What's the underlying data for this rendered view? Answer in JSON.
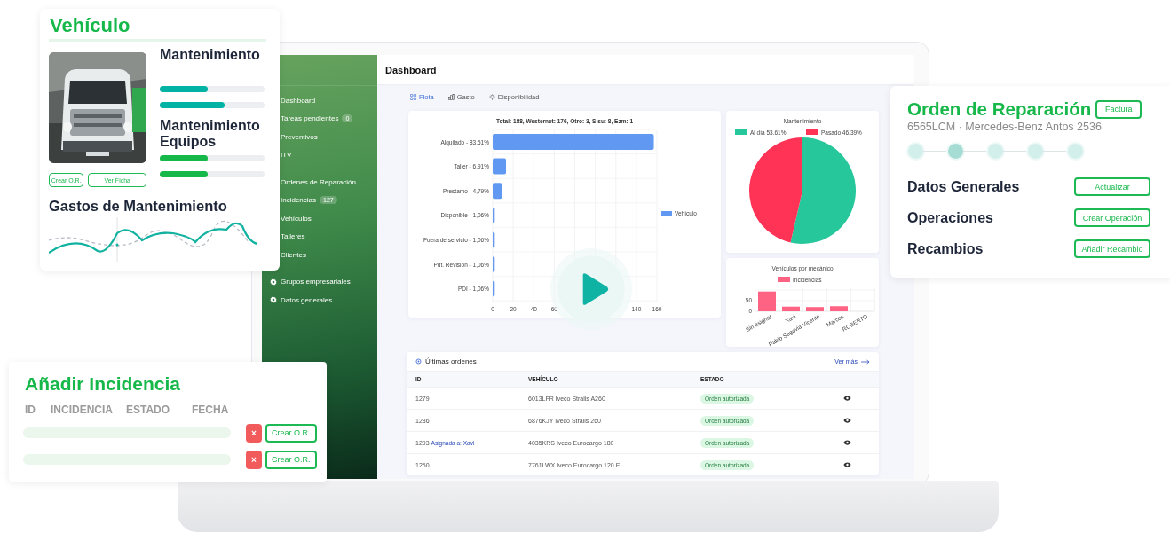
{
  "vehicle_card": {
    "title": "Vehículo",
    "photo": {
      "kind": "picture"
    },
    "sections": [
      {
        "title": "Mantenimiento",
        "color": "#00b3a4",
        "bars": [
          {
            "level": 0.46
          },
          {
            "level": 0.62
          }
        ]
      },
      {
        "title": "Mantenimiento Equipos",
        "color": "#16b84a",
        "bars": [
          {
            "level": 0.46
          },
          {
            "level": 0.46
          }
        ]
      }
    ],
    "buttons": [
      "Crear O.R.",
      "Ver Ficha"
    ],
    "expenses": {
      "title": "Gastos de Mantenimiento"
    }
  },
  "dashboard": {
    "title": "Dashboard",
    "sidebar": {
      "groups": [
        [
          {
            "label": "Dashboard",
            "kind": "plain"
          },
          {
            "label": "Tareas pendientes",
            "badge": "0",
            "kind": "plain"
          },
          {
            "label": "Preventivos",
            "kind": "plain"
          },
          {
            "label": "ITV",
            "kind": "plain"
          }
        ],
        [
          {
            "label": "Ordenes de Reparación",
            "kind": "plain"
          },
          {
            "label": "Incidencias",
            "badge": "127",
            "kind": "plain"
          },
          {
            "label": "Vehículos",
            "kind": "plain"
          },
          {
            "label": "Talleres",
            "kind": "plain"
          },
          {
            "label": "Clientes",
            "kind": "plain"
          }
        ],
        [
          {
            "label": "Grupos empresariales",
            "kind": "settings"
          },
          {
            "label": "Datos generales",
            "kind": "settings"
          }
        ]
      ]
    },
    "tabs": [
      {
        "label": "Flota",
        "kind": "fleet",
        "selected": true
      },
      {
        "label": "Gasto",
        "kind": "spend",
        "selected": false
      },
      {
        "label": "Disponibilidad",
        "kind": "availability",
        "selected": false
      }
    ],
    "fleet_chart": {
      "chart_data": {
        "type": "bar",
        "orientation": "horizontal",
        "title": "Total: 188, Westernet: 176, Otro: 3, Sisu: 8, Ezm: 1",
        "categories": [
          "Alquilado - 83,51%",
          "Taller - 6,91%",
          "Prestamo - 4,79%",
          "Disponible - 1,06%",
          "Fuera de servicio - 1,06%",
          "Pdt. Revisión - 1,06%",
          "PDI - 1,06%"
        ],
        "series": [
          {
            "name": "Vehículo",
            "color": "#6199f2",
            "values": [
              157,
              13,
              9,
              2,
              2,
              2,
              2
            ]
          }
        ],
        "xlim": [
          0,
          160
        ],
        "xticks": [
          0,
          20,
          40,
          60,
          140,
          160
        ],
        "grid": true,
        "legend": "right"
      }
    },
    "maintenance_chart": {
      "chart_data": {
        "type": "pie",
        "title": "Mantenimiento",
        "categories": [
          "Al día 53.61%",
          "Pasado 46.39%"
        ],
        "colors": [
          "#26c79b",
          "#ff3355"
        ],
        "legend": "top",
        "series": [
          {
            "values": [
              53.61,
              46.39
            ]
          }
        ]
      }
    },
    "mechanic_chart": {
      "chart_data": {
        "type": "bar",
        "title": "Vehículos por mecánico",
        "categories": [
          "Sin asignar",
          "Xavi",
          "Pablo Segovia Vicente",
          "Marcos",
          "ROBERTO"
        ],
        "series": [
          {
            "name": "Incidencias",
            "color": "#ff6384",
            "values": [
              93,
              22,
              20,
              24,
              0
            ]
          }
        ],
        "ylim": [
          0,
          100
        ],
        "yticks": [
          0,
          50
        ],
        "grid": true,
        "legend": "top"
      }
    },
    "orders": {
      "title": "Últimas ordenes",
      "link": "Ver más",
      "columns": [
        "ID",
        "VEHÍCULO",
        "ESTADO"
      ],
      "rows": [
        {
          "id": "1279",
          "vehicle": "6013LFR Iveco Stralis A260",
          "status": "Orden autorizada",
          "kind": "authorized"
        },
        {
          "id": "1286",
          "vehicle": "6876KJY Iveco Stralis 260",
          "status": "Orden autorizada",
          "kind": "authorized"
        },
        {
          "id": "1293",
          "note": "Asignada a: Xavi",
          "vehicle": "4035KRS Iveco Eurocargo 180",
          "status": "Orden autorizada",
          "kind": "authorized"
        },
        {
          "id": "1250",
          "vehicle": "7761LWX Iveco Eurocargo 120 E",
          "status": "Orden autorizada",
          "kind": "authorized"
        }
      ]
    }
  },
  "incident_card": {
    "title": "Añadir Incidencia",
    "columns": [
      "ID",
      "INCIDENCIA",
      "ESTADO",
      "FECHA"
    ],
    "rows": [
      {
        "delete": "×",
        "button": "Crear O.R."
      },
      {
        "delete": "×",
        "button": "Crear O.R."
      }
    ]
  },
  "repair_card": {
    "title": "Orden de Reparación",
    "button": "Factura",
    "subtitle": "6565LCM · Mercedes-Benz Antos 2536",
    "steps": [
      {
        "selected": false
      },
      {
        "selected": true
      },
      {
        "selected": false
      },
      {
        "selected": false
      },
      {
        "selected": false
      }
    ],
    "sections": [
      {
        "title": "Datos Generales",
        "button": "Actualizar"
      },
      {
        "title": "Operaciones",
        "button": "Crear Operación"
      },
      {
        "title": "Recambios",
        "button": "Añadir Recambio"
      }
    ]
  }
}
